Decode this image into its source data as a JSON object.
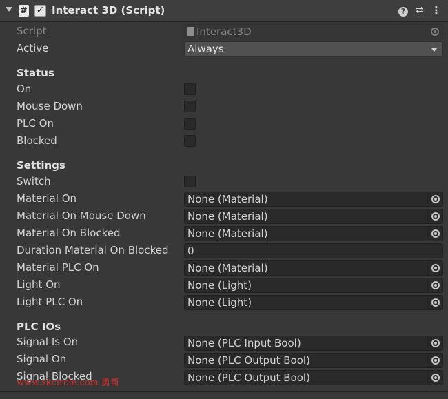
{
  "header": {
    "title": "Interact 3D (Script)",
    "script_icon_glyph": "#",
    "enabled_check": "✓",
    "icons": [
      "hash-script-icon",
      "help-icon",
      "preset-icon",
      "kebab-menu-icon"
    ]
  },
  "script_row": {
    "label": "Script",
    "value": "Interact3D"
  },
  "active_row": {
    "label": "Active",
    "value": "Always"
  },
  "status": {
    "heading": "Status",
    "rows": [
      "On",
      "Mouse Down",
      "PLC On",
      "Blocked"
    ]
  },
  "settings": {
    "heading": "Settings",
    "switch_label": "Switch",
    "material_on": {
      "label": "Material On",
      "value": "None (Material)"
    },
    "material_on_mouse_down": {
      "label": "Material On Mouse Down",
      "value": "None (Material)"
    },
    "material_on_blocked": {
      "label": "Material On Blocked",
      "value": "None (Material)"
    },
    "duration_material_on_blocked": {
      "label": "Duration Material On Blocked",
      "value": "0"
    },
    "material_plc_on": {
      "label": "Material PLC On",
      "value": "None (Material)"
    },
    "light_on": {
      "label": "Light On",
      "value": "None (Light)"
    },
    "light_plc_on": {
      "label": "Light PLC On",
      "value": "None (Light)"
    }
  },
  "plc_ios": {
    "heading": "PLC IOs",
    "signal_is_on": {
      "label": "Signal Is On",
      "value": "None (PLC Input Bool)"
    },
    "signal_on": {
      "label": "Signal On",
      "value": "None (PLC Output Bool)"
    },
    "signal_blocked": {
      "label": "Signal Blocked",
      "value": "None (PLC Output Bool)"
    }
  },
  "watermark": "www.skcircle.com 勇哥",
  "colors": {
    "background": "#383838",
    "field": "#2a2a2a",
    "text": "#d2d2d2",
    "watermark": "#d23030"
  }
}
